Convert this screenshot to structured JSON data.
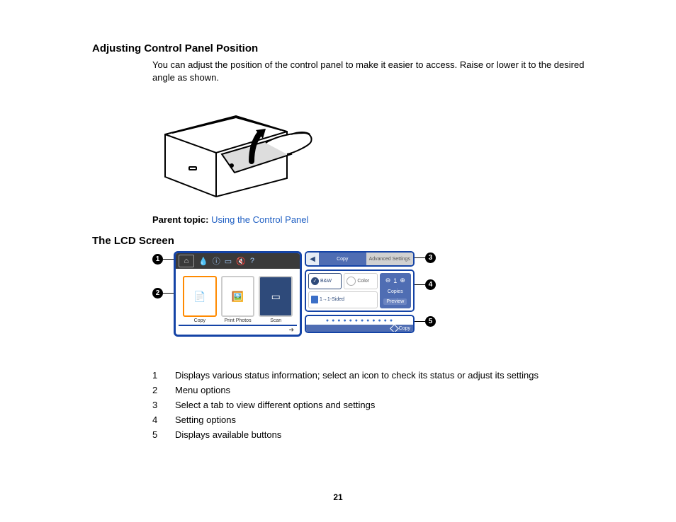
{
  "section1": {
    "title": "Adjusting Control Panel Position",
    "body": "You can adjust the position of the control panel to make it easier to access. Raise or lower it to the desired angle as shown."
  },
  "parent_topic": {
    "label": "Parent topic:",
    "link_text": "Using the Control Panel"
  },
  "section2": {
    "title": "The LCD Screen"
  },
  "lcd": {
    "menu": {
      "copy": "Copy",
      "print_photos": "Print Photos",
      "scan": "Scan"
    },
    "tabs": {
      "copy": "Copy",
      "advanced": "Advanced Settings"
    },
    "options": {
      "bw": "B&W",
      "color": "Color",
      "sided": "1→1-Sided"
    },
    "side": {
      "count": "1",
      "copies": "Copies",
      "preview": "Preview"
    },
    "button": "Copy"
  },
  "callouts": {
    "c1": "1",
    "c2": "2",
    "c3": "3",
    "c4": "4",
    "c5": "5"
  },
  "legend": [
    {
      "n": "1",
      "t": "Displays various status information; select an icon to check its status or adjust its settings"
    },
    {
      "n": "2",
      "t": "Menu options"
    },
    {
      "n": "3",
      "t": "Select a tab to view different options and settings"
    },
    {
      "n": "4",
      "t": "Setting options"
    },
    {
      "n": "5",
      "t": "Displays available buttons"
    }
  ],
  "page_number": "21"
}
